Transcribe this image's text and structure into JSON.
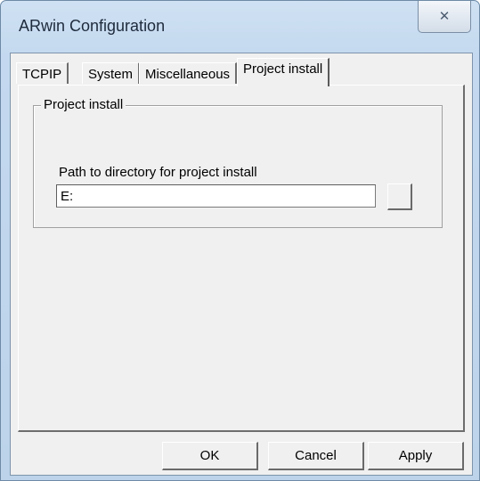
{
  "window": {
    "title": "ARwin Configuration",
    "close_glyph": "✕"
  },
  "tabs": [
    {
      "label": "TCPIP",
      "selected": false
    },
    {
      "label": "System",
      "selected": false
    },
    {
      "label": "Miscellaneous",
      "selected": false
    },
    {
      "label": "Project install",
      "selected": true
    }
  ],
  "project_install": {
    "group_title": "Project install",
    "path_label": "Path to directory for project install",
    "path_value": "E:",
    "browse_label": ""
  },
  "buttons": {
    "ok": "OK",
    "cancel": "Cancel",
    "apply": "Apply"
  }
}
